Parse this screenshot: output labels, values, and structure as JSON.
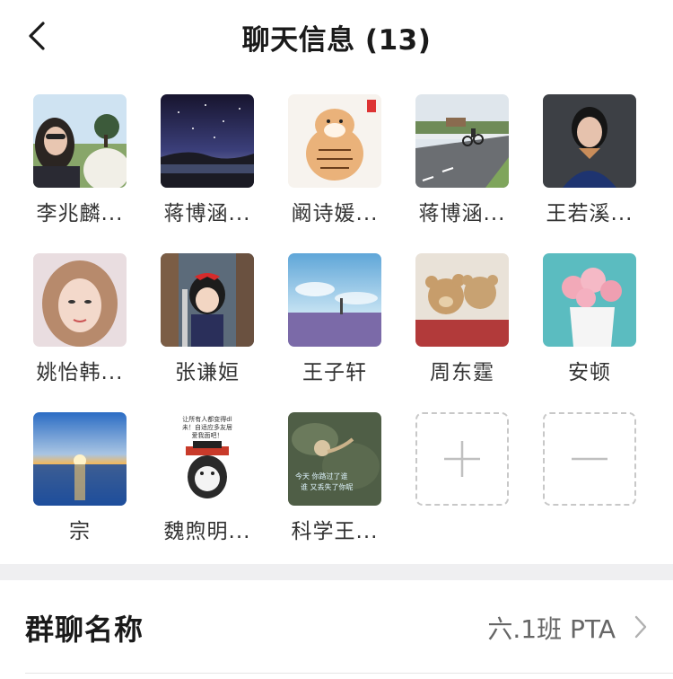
{
  "header": {
    "title": "聊天信息 (13)",
    "back_icon": "chevron-left-icon"
  },
  "members": [
    {
      "name": "李兆麟...",
      "avatar": "woman-with-alpaca-photo"
    },
    {
      "name": "蒋博涵...",
      "avatar": "starry-night-photo"
    },
    {
      "name": "阚诗媛...",
      "avatar": "cartoon-tiger-drawing"
    },
    {
      "name": "蒋博涵...",
      "avatar": "cyclist-road-photo"
    },
    {
      "name": "王若溪...",
      "avatar": "woman-portrait-photo"
    },
    {
      "name": "姚怡韩...",
      "avatar": "woman-selfie-photo"
    },
    {
      "name": "张谦姮",
      "avatar": "anime-girl-train-image"
    },
    {
      "name": "王子轩",
      "avatar": "lavender-field-photo"
    },
    {
      "name": "周东霆",
      "avatar": "teddy-bears-photo"
    },
    {
      "name": "安顿",
      "avatar": "pink-roses-vase-photo"
    },
    {
      "name": "宗",
      "avatar": "sea-sunset-photo"
    },
    {
      "name": "魏煦明...",
      "avatar": "cartoon-cat-with-hat",
      "avatar_text": [
        "让所有人都变得dl",
        "未！自适应多友居",
        "爱我面吧！"
      ]
    },
    {
      "name": "科学王...",
      "avatar": "snail-on-rock-photo",
      "avatar_text": [
        "今天 你路过了谁",
        "谁 又丢失了你呢"
      ]
    }
  ],
  "actions": {
    "add_icon": "plus-icon",
    "remove_icon": "minus-icon"
  },
  "settings": {
    "group_name_label": "群聊名称",
    "group_name_value": "六.1班 PTA",
    "chevron_icon": "chevron-right-icon"
  },
  "colors": {
    "background": "#ffffff",
    "separator": "#efeff1",
    "text": "#1a1a1a",
    "secondary_text": "#666666"
  }
}
